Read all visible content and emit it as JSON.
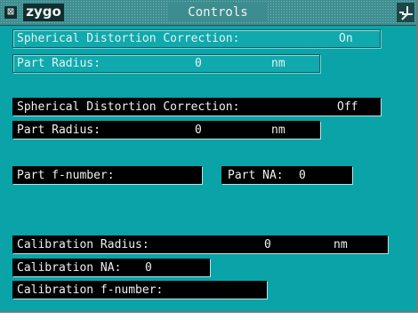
{
  "window": {
    "title": "Controls",
    "logo": "zygo",
    "close_glyph": "⊠"
  },
  "fields": {
    "sdc_1": {
      "label": "Spherical Distortion Correction:",
      "value": "On"
    },
    "radius_1": {
      "label": "Part Radius:",
      "value": "0",
      "unit": "nm"
    },
    "sdc_2": {
      "label": "Spherical Distortion Correction:",
      "value": "Off"
    },
    "radius_2": {
      "label": "Part Radius:",
      "value": "0",
      "unit": "nm"
    },
    "f_number": {
      "label": "Part f-number:"
    },
    "part_na": {
      "label": "Part NA:",
      "value": "0"
    },
    "cal_radius": {
      "label": "Calibration Radius:",
      "value": "0",
      "unit": "nm"
    },
    "cal_na": {
      "label": "Calibration NA:",
      "value": "0"
    },
    "cal_f_number": {
      "label": "Calibration f-number:"
    }
  },
  "colors": {
    "panel": "#0aa3a7",
    "title_bar": "#3d8d90",
    "field_dark": "#000000",
    "field_light": "#10a9ad"
  },
  "icons": {
    "close": "close-box-icon",
    "pin": "pin-icon",
    "logo": "zygo-logo"
  }
}
